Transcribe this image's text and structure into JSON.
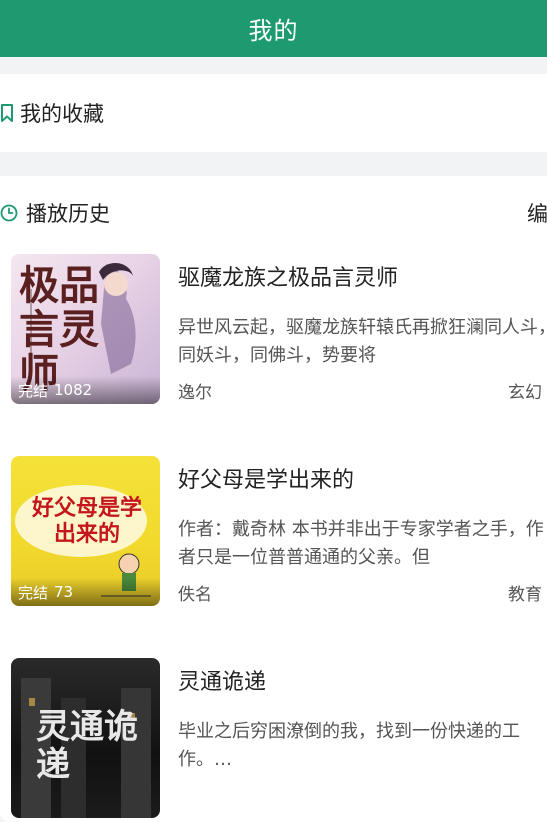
{
  "header": {
    "title": "我的"
  },
  "favorites": {
    "label": "我的收藏",
    "icon": "bookmark-icon"
  },
  "history": {
    "label": "播放历史",
    "edit_label": "编",
    "icon": "clock-icon"
  },
  "books": [
    {
      "title": "驱魔龙族之极品言灵师",
      "desc": "异世风云起，驱魔龙族轩辕氏再掀狂澜同人斗，同妖斗，同佛斗，势要将",
      "author": "逸尔",
      "genre": "玄幻",
      "status": "完结",
      "count": "1082",
      "cover_text": "极品言灵师"
    },
    {
      "title": "好父母是学出来的",
      "desc": "作者：戴奇林 本书并非出于专家学者之手，作者只是一位普普通通的父亲。但",
      "author": "佚名",
      "genre": "教育",
      "status": "完结",
      "count": "73",
      "cover_text": "好父母是学出来的"
    },
    {
      "title": "灵通诡递",
      "desc": "毕业之后穷困潦倒的我，找到一份快递的工作。…",
      "author": "",
      "genre": "",
      "status": "",
      "count": "",
      "cover_text": "灵通诡递"
    }
  ],
  "colors": {
    "accent": "#1e9a70",
    "background": "#f2f3f5"
  }
}
